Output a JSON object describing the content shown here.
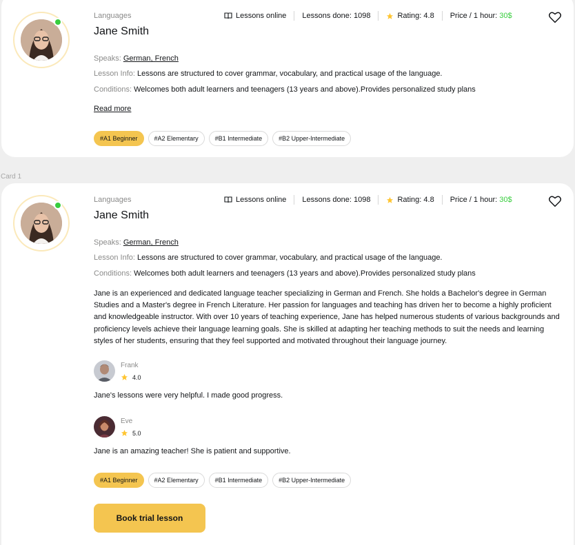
{
  "card_caption": "Card 1",
  "teacher": {
    "languages_label": "Languages",
    "name": "Jane Smith",
    "stats": {
      "lessons_online": "Lessons online",
      "lessons_done": "Lessons done: 1098",
      "rating": "Rating: 4.8",
      "price_label": "Price / 1 hour: ",
      "price_value": "30$"
    },
    "speaks_label": "Speaks: ",
    "speaks_value": "German, French",
    "lesson_info_label": "Lesson Info: ",
    "lesson_info_value": "Lessons are structured to cover grammar, vocabulary, and practical usage of the language.",
    "conditions_label": "Conditions: ",
    "conditions_value": "Welcomes both adult learners and teenagers (13 years and above).Provides personalized study plans",
    "read_more": "Read more",
    "bio": "Jane is an experienced and dedicated language teacher specializing in German and French. She holds a Bachelor's degree in German Studies and a Master's degree in French Literature. Her passion for languages and teaching has driven her to become a highly proficient and knowledgeable instructor. With over 10 years of teaching experience, Jane has helped numerous students of various backgrounds and proficiency levels achieve their language learning goals. She is skilled at adapting her teaching methods to suit the needs and learning styles of her students, ensuring that they feel supported and motivated throughout their language journey.",
    "levels": [
      "#A1 Beginner",
      "#A2 Elementary",
      "#B1 Intermediate",
      "#B2 Upper-Intermediate"
    ],
    "reviews": [
      {
        "name": "Frank",
        "rating": "4.0",
        "comment": "Jane's lessons were very helpful. I made good progress."
      },
      {
        "name": "Eve",
        "rating": "5.0",
        "comment": "Jane is an amazing teacher! She is patient and supportive."
      }
    ],
    "book_button": "Book trial lesson"
  },
  "colors": {
    "accent": "#f4c550",
    "online": "#38cd3e",
    "muted": "#8a8a89",
    "text": "#121417"
  },
  "icons": [
    "book-icon",
    "star-icon",
    "heart-icon"
  ]
}
